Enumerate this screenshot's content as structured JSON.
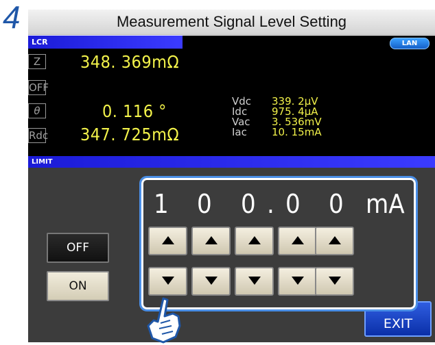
{
  "step_number": "4",
  "title": "Measurement Signal Level Setting",
  "screen": {
    "lcr_label": "LCR",
    "lan_label": "LAN",
    "params": [
      "Z",
      "OFF",
      "θ",
      "Rdc"
    ],
    "values": {
      "z": "348. 369mΩ",
      "theta": "0. 116 °",
      "rdc": "347. 725mΩ"
    },
    "monitors": [
      {
        "label": "Vdc",
        "value": "339. 2μV"
      },
      {
        "label": "Idc",
        "value": "975. 4μA"
      },
      {
        "label": "Vac",
        "value": "3. 536mV"
      },
      {
        "label": "Iac",
        "value": "10. 15mA"
      }
    ],
    "limit_label": "LIMIT"
  },
  "limit_panel": {
    "off_label": "OFF",
    "on_label": "ON",
    "exit_label": "EXIT",
    "level_digits": [
      "1",
      "0",
      "0",
      ".",
      "0",
      "0"
    ],
    "level_unit": "mA"
  },
  "colors": {
    "accent": "#1f57a8",
    "screen_tab": "#2626e6",
    "value_yellow": "#f2f24a",
    "highlight": "#4a8ee6"
  }
}
